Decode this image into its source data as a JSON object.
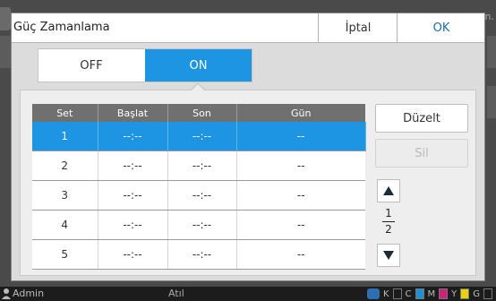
{
  "dialog": {
    "title": "Güç Zamanlama",
    "cancel_label": "İptal",
    "ok_label": "OK"
  },
  "toggle": {
    "off_label": "OFF",
    "on_label": "ON",
    "selected": "ON"
  },
  "schedule": {
    "headers": [
      "Set",
      "Başlat",
      "Son",
      "Gün"
    ],
    "rows": [
      {
        "set": "1",
        "start": "--:--",
        "end": "--:--",
        "day": "--"
      },
      {
        "set": "2",
        "start": "--:--",
        "end": "--:--",
        "day": "--"
      },
      {
        "set": "3",
        "start": "--:--",
        "end": "--:--",
        "day": "--"
      },
      {
        "set": "4",
        "start": "--:--",
        "end": "--:--",
        "day": "--"
      },
      {
        "set": "5",
        "start": "--:--",
        "end": "--:--",
        "day": "--"
      }
    ],
    "selected_row": 1
  },
  "actions": {
    "edit_label": "Düzelt",
    "delete_label": "Sil"
  },
  "pager": {
    "current": "1",
    "total": "2"
  },
  "background": {
    "right_text": "n."
  },
  "statusbar": {
    "user": "Admin",
    "center": "Atıl",
    "inks": [
      "K",
      "C",
      "M",
      "Y",
      "G"
    ]
  },
  "colors": {
    "accent": "#1e95e2",
    "ok_text": "#1a6fb0",
    "header_bg": "#707070",
    "ink_C": "#1f8fd6",
    "ink_M": "#d0217a",
    "ink_Y": "#e8d400"
  }
}
